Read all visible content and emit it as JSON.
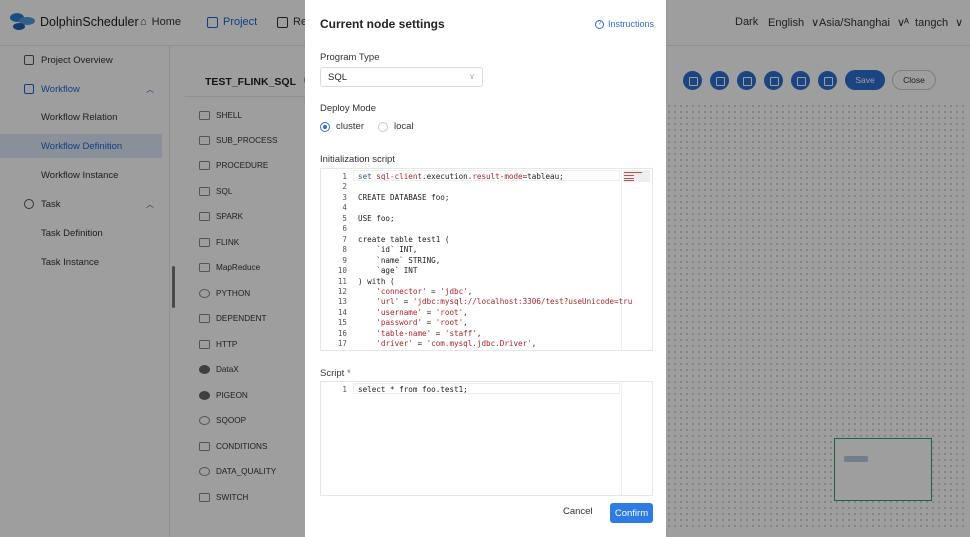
{
  "brand": {
    "name": "DolphinScheduler"
  },
  "nav": {
    "home": "Home",
    "project": "Project",
    "resources": "Re",
    "theme": "Dark",
    "language": "English",
    "timezone": "Asia/Shanghai",
    "user": "tangch"
  },
  "sidebar": {
    "items": [
      {
        "label": "Project Overview"
      },
      {
        "label": "Workflow"
      },
      {
        "label": "Workflow Relation"
      },
      {
        "label": "Workflow Definition"
      },
      {
        "label": "Workflow Instance"
      },
      {
        "label": "Task"
      },
      {
        "label": "Task Definition"
      },
      {
        "label": "Task Instance"
      }
    ]
  },
  "workflow": {
    "name": "TEST_FLINK_SQL",
    "tasks": [
      "SHELL",
      "SUB_PROCESS",
      "PROCEDURE",
      "SQL",
      "SPARK",
      "FLINK",
      "MapReduce",
      "PYTHON",
      "DEPENDENT",
      "HTTP",
      "DataX",
      "PIGEON",
      "SQOOP",
      "CONDITIONS",
      "DATA_QUALITY",
      "SWITCH"
    ],
    "save_label": "Save",
    "close_label": "Close"
  },
  "drawer": {
    "title": "Current node settings",
    "instructions": "Instructions",
    "program_type_label": "Program Type",
    "program_type_value": "SQL",
    "deploy_mode_label": "Deploy Mode",
    "deploy_modes": [
      "cluster",
      "local"
    ],
    "deploy_mode_selected": "cluster",
    "init_script_label": "Initialization script",
    "init_script_lines": [
      "set sql-client.execution.result-mode=tableau;",
      "",
      "CREATE DATABASE foo;",
      "",
      "USE foo;",
      "",
      "create table test1 (",
      "    `id` INT,",
      "    `name` STRING,",
      "    `age` INT",
      ") with (",
      "    'connector' = 'jdbc',",
      "    'url' = 'jdbc:mysql://localhost:3306/test?useUnicode=tru",
      "    'username' = 'root',",
      "    'password' = 'root',",
      "    'table-name' = 'staff',",
      "    'driver' = 'com.mysql.jdbc.Driver',"
    ],
    "script_label": "Script",
    "script_required": "*",
    "script_lines": [
      "select * from foo.test1;"
    ],
    "cancel_label": "Cancel",
    "confirm_label": "Confirm"
  },
  "colors": {
    "accent": "#2d6fd2",
    "selected_bg": "#dfe8f7",
    "minimap_border": "#2aa56a"
  }
}
